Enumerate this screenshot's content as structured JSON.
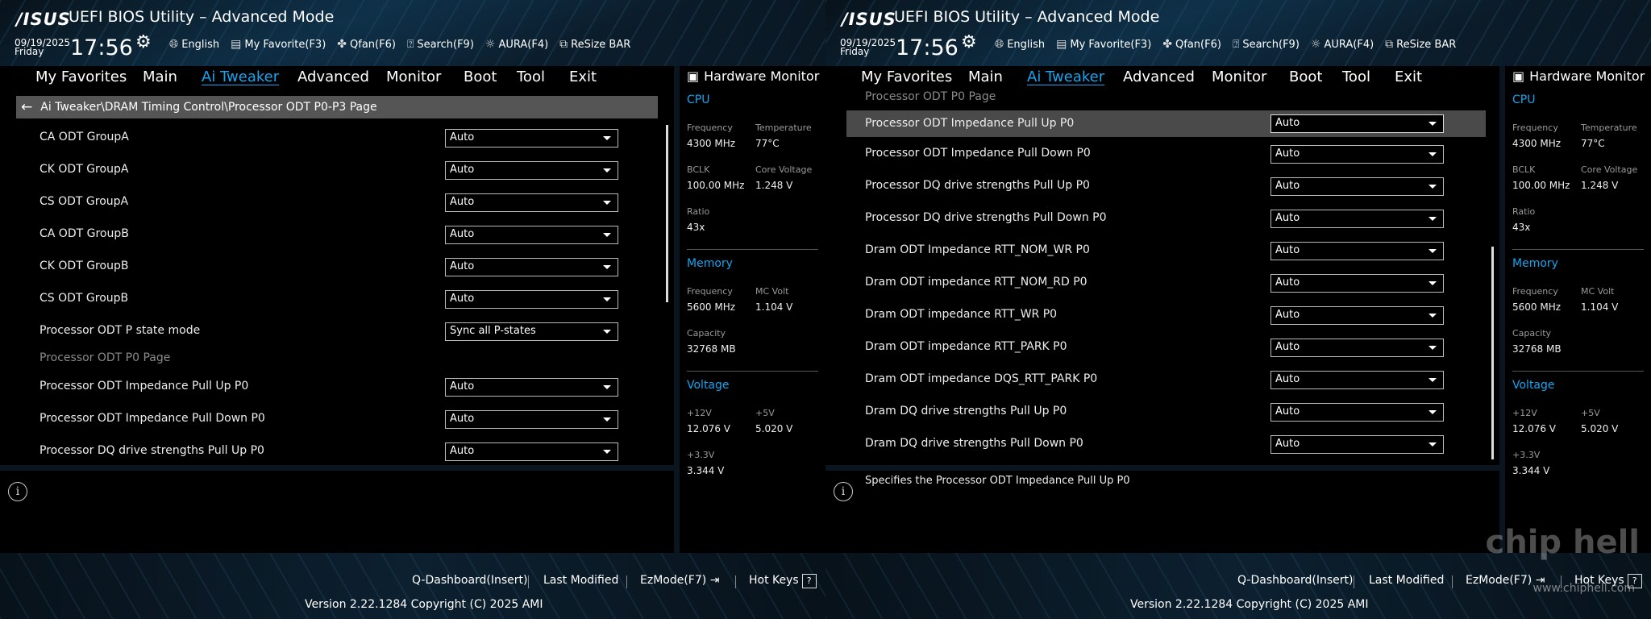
{
  "header": {
    "logo": "/ISUS",
    "title": "UEFI BIOS Utility – Advanced Mode",
    "date": "09/19/2025",
    "day": "Friday",
    "time": "17:56",
    "toolbar": [
      "English",
      "My Favorite(F3)",
      "Qfan(F6)",
      "Search(F9)",
      "AURA(F4)",
      "ReSize BAR"
    ],
    "toolbar_icons": [
      "globe-icon",
      "favorite-icon",
      "fan-icon",
      "search-icon",
      "aura-icon",
      "resize-bar-icon"
    ]
  },
  "nav": [
    "My Favorites",
    "Main",
    "Ai Tweaker",
    "Advanced",
    "Monitor",
    "Boot",
    "Tool",
    "Exit"
  ],
  "nav_active": "Ai Tweaker",
  "left": {
    "breadcrumb": "Ai Tweaker\\DRAM Timing Control\\Processor ODT P0-P3 Page",
    "rows": [
      {
        "label": "CA ODT GroupA",
        "value": "Auto"
      },
      {
        "label": "CK ODT GroupA",
        "value": "Auto"
      },
      {
        "label": "CS ODT GroupA",
        "value": "Auto"
      },
      {
        "label": "CA ODT GroupB",
        "value": "Auto"
      },
      {
        "label": "CK ODT GroupB",
        "value": "Auto"
      },
      {
        "label": "CS ODT GroupB",
        "value": "Auto"
      },
      {
        "label": "Processor ODT P state mode",
        "value": "Sync all P-states"
      },
      {
        "label": "Processor ODT P0 Page",
        "value": null
      },
      {
        "label": "Processor ODT Impedance Pull Up P0",
        "value": "Auto"
      },
      {
        "label": "Processor ODT Impedance Pull Down P0",
        "value": "Auto"
      },
      {
        "label": "Processor DQ drive strengths Pull Up P0",
        "value": "Auto"
      }
    ],
    "help_text": ""
  },
  "right": {
    "partial_heading": "Processor ODT P0 Page",
    "rows": [
      {
        "label": "Processor ODT Impedance Pull Up P0",
        "value": "Auto"
      },
      {
        "label": "Processor ODT Impedance Pull Down P0",
        "value": "Auto"
      },
      {
        "label": "Processor DQ drive strengths Pull Up P0",
        "value": "Auto"
      },
      {
        "label": "Processor DQ drive strengths Pull Down P0",
        "value": "Auto"
      },
      {
        "label": "Dram ODT Impedance RTT_NOM_WR P0",
        "value": "Auto"
      },
      {
        "label": "Dram ODT impedance RTT_NOM_RD P0",
        "value": "Auto"
      },
      {
        "label": "Dram ODT impedance RTT_WR P0",
        "value": "Auto"
      },
      {
        "label": "Dram ODT impedance RTT_PARK P0",
        "value": "Auto"
      },
      {
        "label": "Dram ODT impedance DQS_RTT_PARK P0",
        "value": "Auto"
      },
      {
        "label": "Dram DQ drive strengths Pull Up P0",
        "value": "Auto"
      },
      {
        "label": "Dram DQ drive strengths Pull Down P0",
        "value": "Auto"
      }
    ],
    "help_text": "Specifies the Processor ODT Impedance Pull Up P0"
  },
  "hw_monitor": {
    "title": "Hardware Monitor",
    "cpu": {
      "heading": "CPU",
      "frequency_label": "Frequency",
      "frequency": "4300 MHz",
      "temperature_label": "Temperature",
      "temperature": "77°C",
      "bclk_label": "BCLK",
      "bclk": "100.00 MHz",
      "core_voltage_label": "Core Voltage",
      "core_voltage": "1.248 V",
      "ratio_label": "Ratio",
      "ratio": "43x"
    },
    "memory": {
      "heading": "Memory",
      "frequency_label": "Frequency",
      "frequency": "5600 MHz",
      "mc_volt_label": "MC Volt",
      "mc_volt": "1.104 V",
      "capacity_label": "Capacity",
      "capacity": "32768 MB"
    },
    "voltage": {
      "heading": "Voltage",
      "v12_label": "+12V",
      "v12": "12.076 V",
      "v5_label": "+5V",
      "v5": "5.020 V",
      "v33_label": "+3.3V",
      "v33": "3.344 V"
    }
  },
  "footer": {
    "items": [
      "Q-Dashboard(Insert)",
      "Last Modified",
      "EzMode(F7)",
      "Hot Keys"
    ],
    "hotkeys_box": "?",
    "version": "Version 2.22.1284 Copyright (C) 2025 AMI"
  },
  "watermark": {
    "logo": "chip hell",
    "url": "www.chiphell.com"
  },
  "colors": {
    "accent": "#16a5ee",
    "highlight_row": "#4a4a4a",
    "breadcrumb_bg": "#555555"
  }
}
